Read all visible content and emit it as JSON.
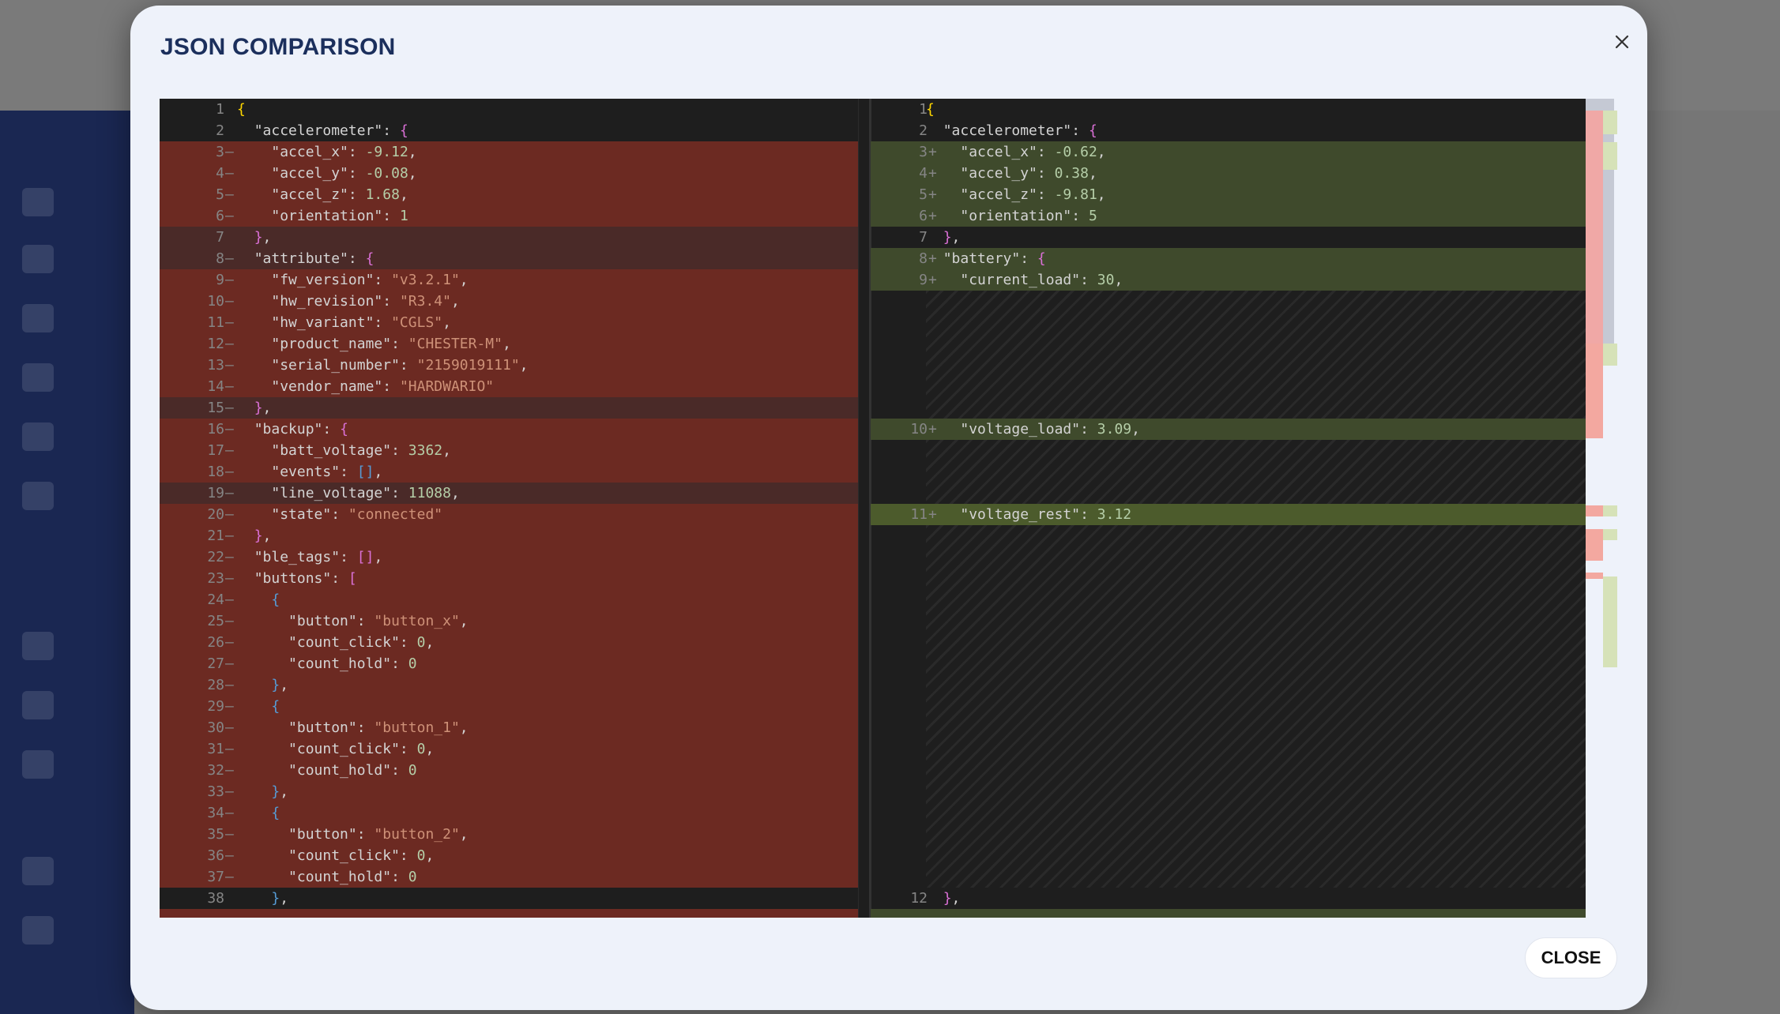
{
  "dialog": {
    "title": "JSON COMPARISON",
    "close_label": "CLOSE",
    "close_icon": "close-icon"
  },
  "left_lines": [
    {
      "n": "1",
      "m": "",
      "t": [
        [
          "{",
          "brace"
        ]
      ],
      "bg": ""
    },
    {
      "n": "2",
      "m": "",
      "t": [
        [
          "  ",
          "p"
        ],
        [
          "\"accelerometer\"",
          "kq"
        ],
        [
          ": ",
          "p"
        ],
        [
          "{",
          "brace2"
        ]
      ],
      "bg": ""
    },
    {
      "n": "3",
      "m": "—",
      "t": [
        [
          "    ",
          "p"
        ],
        [
          "\"accel_x\"",
          "kq"
        ],
        [
          ": ",
          "p"
        ],
        [
          "-9.12",
          "num"
        ],
        [
          ",",
          "p"
        ]
      ],
      "bg": "del"
    },
    {
      "n": "4",
      "m": "—",
      "t": [
        [
          "    ",
          "p"
        ],
        [
          "\"accel_y\"",
          "kq"
        ],
        [
          ": ",
          "p"
        ],
        [
          "-0.08",
          "num"
        ],
        [
          ",",
          "p"
        ]
      ],
      "bg": "del"
    },
    {
      "n": "5",
      "m": "—",
      "t": [
        [
          "    ",
          "p"
        ],
        [
          "\"accel_z\"",
          "kq"
        ],
        [
          ": ",
          "p"
        ],
        [
          "1.68",
          "num"
        ],
        [
          ",",
          "p"
        ]
      ],
      "bg": "del"
    },
    {
      "n": "6",
      "m": "—",
      "t": [
        [
          "    ",
          "p"
        ],
        [
          "\"orientation\"",
          "kq"
        ],
        [
          ": ",
          "p"
        ],
        [
          "1",
          "num"
        ]
      ],
      "bg": "del"
    },
    {
      "n": "7",
      "m": "",
      "t": [
        [
          "  ",
          "p"
        ],
        [
          "}",
          "brace2"
        ],
        [
          ",",
          "p"
        ]
      ],
      "bg": "del-light"
    },
    {
      "n": "8",
      "m": "—",
      "t": [
        [
          "  ",
          "p"
        ],
        [
          "\"attribute\"",
          "kq"
        ],
        [
          ": ",
          "p"
        ],
        [
          "{",
          "brace2"
        ]
      ],
      "bg": "del-light"
    },
    {
      "n": "9",
      "m": "—",
      "t": [
        [
          "    ",
          "p"
        ],
        [
          "\"fw_version\"",
          "kq"
        ],
        [
          ": ",
          "p"
        ],
        [
          "\"v3.2.1\"",
          "str"
        ],
        [
          ",",
          "p"
        ]
      ],
      "bg": "del"
    },
    {
      "n": "10",
      "m": "—",
      "t": [
        [
          "    ",
          "p"
        ],
        [
          "\"hw_revision\"",
          "kq"
        ],
        [
          ": ",
          "p"
        ],
        [
          "\"R3.4\"",
          "str"
        ],
        [
          ",",
          "p"
        ]
      ],
      "bg": "del"
    },
    {
      "n": "11",
      "m": "—",
      "t": [
        [
          "    ",
          "p"
        ],
        [
          "\"hw_variant\"",
          "kq"
        ],
        [
          ": ",
          "p"
        ],
        [
          "\"CGLS\"",
          "str"
        ],
        [
          ",",
          "p"
        ]
      ],
      "bg": "del"
    },
    {
      "n": "12",
      "m": "—",
      "t": [
        [
          "    ",
          "p"
        ],
        [
          "\"product_name\"",
          "kq"
        ],
        [
          ": ",
          "p"
        ],
        [
          "\"CHESTER-M\"",
          "str"
        ],
        [
          ",",
          "p"
        ]
      ],
      "bg": "del"
    },
    {
      "n": "13",
      "m": "—",
      "t": [
        [
          "    ",
          "p"
        ],
        [
          "\"serial_number\"",
          "kq"
        ],
        [
          ": ",
          "p"
        ],
        [
          "\"2159019111\"",
          "str"
        ],
        [
          ",",
          "p"
        ]
      ],
      "bg": "del"
    },
    {
      "n": "14",
      "m": "—",
      "t": [
        [
          "    ",
          "p"
        ],
        [
          "\"vendor_name\"",
          "kq"
        ],
        [
          ": ",
          "p"
        ],
        [
          "\"HARDWARIO\"",
          "str"
        ]
      ],
      "bg": "del"
    },
    {
      "n": "15",
      "m": "—",
      "t": [
        [
          "  ",
          "p"
        ],
        [
          "}",
          "brace2"
        ],
        [
          ",",
          "p"
        ]
      ],
      "bg": "del-light"
    },
    {
      "n": "16",
      "m": "—",
      "t": [
        [
          "  ",
          "p"
        ],
        [
          "\"backup\"",
          "kq"
        ],
        [
          ": ",
          "p"
        ],
        [
          "{",
          "brace2"
        ]
      ],
      "bg": "del"
    },
    {
      "n": "17",
      "m": "—",
      "t": [
        [
          "    ",
          "p"
        ],
        [
          "\"batt_voltage\"",
          "kq"
        ],
        [
          ": ",
          "p"
        ],
        [
          "3362",
          "num"
        ],
        [
          ",",
          "p"
        ]
      ],
      "bg": "del"
    },
    {
      "n": "18",
      "m": "—",
      "t": [
        [
          "    ",
          "p"
        ],
        [
          "\"events\"",
          "kq"
        ],
        [
          ": ",
          "p"
        ],
        [
          "[]",
          "brace3"
        ],
        [
          ",",
          "p"
        ]
      ],
      "bg": "del"
    },
    {
      "n": "19",
      "m": "—",
      "t": [
        [
          "    ",
          "p"
        ],
        [
          "\"line_voltage\"",
          "kq"
        ],
        [
          ": ",
          "p"
        ],
        [
          "11088",
          "num"
        ],
        [
          ",",
          "p"
        ]
      ],
      "bg": "del-light"
    },
    {
      "n": "20",
      "m": "—",
      "t": [
        [
          "    ",
          "p"
        ],
        [
          "\"state\"",
          "kq"
        ],
        [
          ": ",
          "p"
        ],
        [
          "\"connected\"",
          "str"
        ]
      ],
      "bg": "del"
    },
    {
      "n": "21",
      "m": "—",
      "t": [
        [
          "  ",
          "p"
        ],
        [
          "}",
          "brace2"
        ],
        [
          ",",
          "p"
        ]
      ],
      "bg": "del"
    },
    {
      "n": "22",
      "m": "—",
      "t": [
        [
          "  ",
          "p"
        ],
        [
          "\"ble_tags\"",
          "kq"
        ],
        [
          ": ",
          "p"
        ],
        [
          "[]",
          "brace2"
        ],
        [
          ",",
          "p"
        ]
      ],
      "bg": "del"
    },
    {
      "n": "23",
      "m": "—",
      "t": [
        [
          "  ",
          "p"
        ],
        [
          "\"buttons\"",
          "kq"
        ],
        [
          ": ",
          "p"
        ],
        [
          "[",
          "brace2"
        ]
      ],
      "bg": "del"
    },
    {
      "n": "24",
      "m": "—",
      "t": [
        [
          "    ",
          "p"
        ],
        [
          "{",
          "brace3"
        ]
      ],
      "bg": "del"
    },
    {
      "n": "25",
      "m": "—",
      "t": [
        [
          "      ",
          "p"
        ],
        [
          "\"button\"",
          "kq"
        ],
        [
          ": ",
          "p"
        ],
        [
          "\"button_x\"",
          "str"
        ],
        [
          ",",
          "p"
        ]
      ],
      "bg": "del"
    },
    {
      "n": "26",
      "m": "—",
      "t": [
        [
          "      ",
          "p"
        ],
        [
          "\"count_click\"",
          "kq"
        ],
        [
          ": ",
          "p"
        ],
        [
          "0",
          "num"
        ],
        [
          ",",
          "p"
        ]
      ],
      "bg": "del"
    },
    {
      "n": "27",
      "m": "—",
      "t": [
        [
          "      ",
          "p"
        ],
        [
          "\"count_hold\"",
          "kq"
        ],
        [
          ": ",
          "p"
        ],
        [
          "0",
          "num"
        ]
      ],
      "bg": "del"
    },
    {
      "n": "28",
      "m": "—",
      "t": [
        [
          "    ",
          "p"
        ],
        [
          "}",
          "brace3"
        ],
        [
          ",",
          "p"
        ]
      ],
      "bg": "del"
    },
    {
      "n": "29",
      "m": "—",
      "t": [
        [
          "    ",
          "p"
        ],
        [
          "{",
          "brace3"
        ]
      ],
      "bg": "del"
    },
    {
      "n": "30",
      "m": "—",
      "t": [
        [
          "      ",
          "p"
        ],
        [
          "\"button\"",
          "kq"
        ],
        [
          ": ",
          "p"
        ],
        [
          "\"button_1\"",
          "str"
        ],
        [
          ",",
          "p"
        ]
      ],
      "bg": "del"
    },
    {
      "n": "31",
      "m": "—",
      "t": [
        [
          "      ",
          "p"
        ],
        [
          "\"count_click\"",
          "kq"
        ],
        [
          ": ",
          "p"
        ],
        [
          "0",
          "num"
        ],
        [
          ",",
          "p"
        ]
      ],
      "bg": "del"
    },
    {
      "n": "32",
      "m": "—",
      "t": [
        [
          "      ",
          "p"
        ],
        [
          "\"count_hold\"",
          "kq"
        ],
        [
          ": ",
          "p"
        ],
        [
          "0",
          "num"
        ]
      ],
      "bg": "del"
    },
    {
      "n": "33",
      "m": "—",
      "t": [
        [
          "    ",
          "p"
        ],
        [
          "}",
          "brace3"
        ],
        [
          ",",
          "p"
        ]
      ],
      "bg": "del"
    },
    {
      "n": "34",
      "m": "—",
      "t": [
        [
          "    ",
          "p"
        ],
        [
          "{",
          "brace3"
        ]
      ],
      "bg": "del"
    },
    {
      "n": "35",
      "m": "—",
      "t": [
        [
          "      ",
          "p"
        ],
        [
          "\"button\"",
          "kq"
        ],
        [
          ": ",
          "p"
        ],
        [
          "\"button_2\"",
          "str"
        ],
        [
          ",",
          "p"
        ]
      ],
      "bg": "del"
    },
    {
      "n": "36",
      "m": "—",
      "t": [
        [
          "      ",
          "p"
        ],
        [
          "\"count_click\"",
          "kq"
        ],
        [
          ": ",
          "p"
        ],
        [
          "0",
          "num"
        ],
        [
          ",",
          "p"
        ]
      ],
      "bg": "del"
    },
    {
      "n": "37",
      "m": "—",
      "t": [
        [
          "      ",
          "p"
        ],
        [
          "\"count_hold\"",
          "kq"
        ],
        [
          ": ",
          "p"
        ],
        [
          "0",
          "num"
        ]
      ],
      "bg": "del"
    },
    {
      "n": "38",
      "m": "",
      "t": [
        [
          "    ",
          "p"
        ],
        [
          "}",
          "brace3"
        ],
        [
          ",",
          "p"
        ]
      ],
      "bg": ""
    }
  ],
  "right_lines": [
    {
      "n": "1",
      "m": "",
      "t": [
        [
          "{",
          "brace"
        ]
      ],
      "bg": "",
      "row": 0
    },
    {
      "n": "2",
      "m": "",
      "t": [
        [
          "  ",
          "p"
        ],
        [
          "\"accelerometer\"",
          "kq"
        ],
        [
          ": ",
          "p"
        ],
        [
          "{",
          "brace2"
        ]
      ],
      "bg": "",
      "row": 1
    },
    {
      "n": "3",
      "m": "+",
      "t": [
        [
          "    ",
          "p"
        ],
        [
          "\"accel_x\"",
          "kq"
        ],
        [
          ": ",
          "p"
        ],
        [
          "-0.62",
          "num"
        ],
        [
          ",",
          "p"
        ]
      ],
      "bg": "add",
      "row": 2
    },
    {
      "n": "4",
      "m": "+",
      "t": [
        [
          "    ",
          "p"
        ],
        [
          "\"accel_y\"",
          "kq"
        ],
        [
          ": ",
          "p"
        ],
        [
          "0.38",
          "num"
        ],
        [
          ",",
          "p"
        ]
      ],
      "bg": "add",
      "row": 3
    },
    {
      "n": "5",
      "m": "+",
      "t": [
        [
          "    ",
          "p"
        ],
        [
          "\"accel_z\"",
          "kq"
        ],
        [
          ": ",
          "p"
        ],
        [
          "-9.81",
          "num"
        ],
        [
          ",",
          "p"
        ]
      ],
      "bg": "add",
      "row": 4
    },
    {
      "n": "6",
      "m": "+",
      "t": [
        [
          "    ",
          "p"
        ],
        [
          "\"orientation\"",
          "kq"
        ],
        [
          ": ",
          "p"
        ],
        [
          "5",
          "num"
        ]
      ],
      "bg": "add",
      "row": 5
    },
    {
      "n": "7",
      "m": "",
      "t": [
        [
          "  ",
          "p"
        ],
        [
          "}",
          "brace2"
        ],
        [
          ",",
          "p"
        ]
      ],
      "bg": "",
      "row": 6
    },
    {
      "n": "8",
      "m": "+",
      "t": [
        [
          "  ",
          "p"
        ],
        [
          "\"battery\"",
          "kq"
        ],
        [
          ": ",
          "p"
        ],
        [
          "{",
          "brace2"
        ]
      ],
      "bg": "add",
      "row": 7
    },
    {
      "n": "9",
      "m": "+",
      "t": [
        [
          "    ",
          "p"
        ],
        [
          "\"current_load\"",
          "kq"
        ],
        [
          ": ",
          "p"
        ],
        [
          "30",
          "num"
        ],
        [
          ",",
          "p"
        ]
      ],
      "bg": "add",
      "row": 8
    },
    {
      "n": "10",
      "m": "+",
      "t": [
        [
          "    ",
          "p"
        ],
        [
          "\"voltage_load\"",
          "kq"
        ],
        [
          ": ",
          "p"
        ],
        [
          "3.09",
          "num"
        ],
        [
          ",",
          "p"
        ]
      ],
      "bg": "add",
      "row": 15
    },
    {
      "n": "11",
      "m": "+",
      "t": [
        [
          "    ",
          "p"
        ],
        [
          "\"voltage_rest\"",
          "kq"
        ],
        [
          ": ",
          "p"
        ],
        [
          "3.12",
          "num"
        ]
      ],
      "bg": "add-strong",
      "row": 19
    },
    {
      "n": "12",
      "m": "",
      "t": [
        [
          "  ",
          "p"
        ],
        [
          "}",
          "brace2"
        ],
        [
          ",",
          "p"
        ]
      ],
      "bg": "",
      "row": 37
    }
  ],
  "colors": {
    "deleted": "#6c2a22",
    "inserted": "#3f4a2c",
    "accent": "#1b2f5c"
  }
}
